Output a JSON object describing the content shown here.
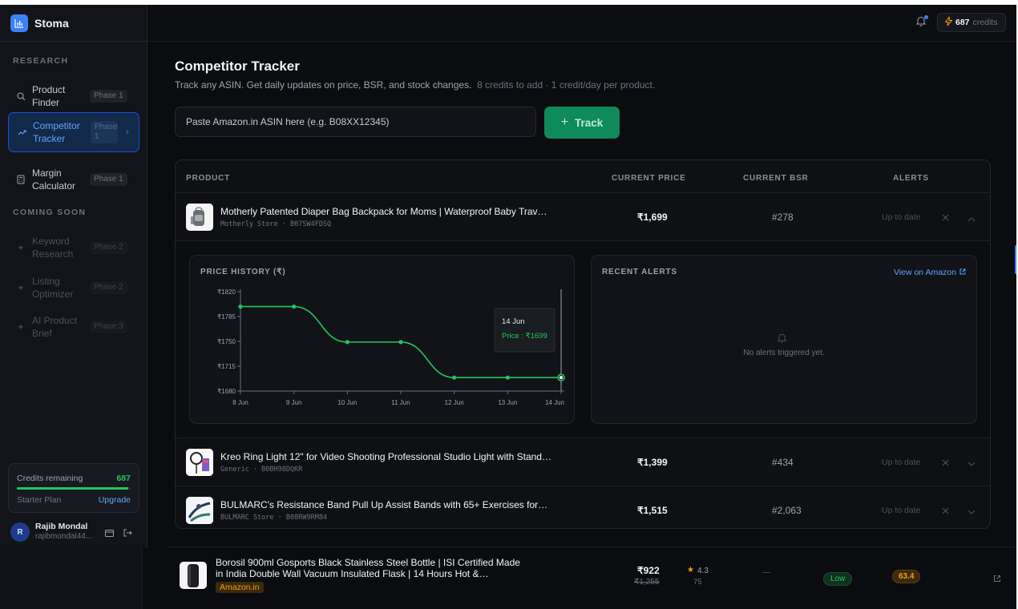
{
  "brand": {
    "name": "Stoma"
  },
  "sidebar": {
    "research_heading": "RESEARCH",
    "coming_soon_heading": "COMING SOON",
    "items": [
      {
        "label": "Product Finder",
        "badge": "Phase 1",
        "icon": "search-icon"
      },
      {
        "label": "Competitor Tracker",
        "badge": "Phase 1",
        "icon": "trend-icon"
      },
      {
        "label": "Margin Calculator",
        "badge": "Phase 1",
        "icon": "calculator-icon"
      },
      {
        "label": "Keyword Research",
        "badge": "Phase 2",
        "icon": "sparkle-icon"
      },
      {
        "label": "Listing Optimizer",
        "badge": "Phase 2",
        "icon": "sparkle-icon"
      },
      {
        "label": "AI Product Brief",
        "badge": "Phase 3",
        "icon": "sparkle-icon"
      }
    ],
    "credits": {
      "label": "Credits remaining",
      "value": "687",
      "fill_pct": 97,
      "plan": "Starter Plan",
      "upgrade": "Upgrade"
    },
    "user": {
      "initial": "R",
      "name": "Rajib Mondal",
      "email": "rajibmondal44..."
    }
  },
  "topbar": {
    "credits_num": "687",
    "credits_word": "credits"
  },
  "page": {
    "title": "Competitor Tracker",
    "subtitle": "Track any ASIN. Get daily updates on price, BSR, and stock changes.",
    "subtitle_note": "8 credits to add · 1 credit/day per product.",
    "input_placeholder": "Paste Amazon.in ASIN here (e.g. B08XX12345)",
    "track_label": "Track"
  },
  "table": {
    "headers": {
      "product": "PRODUCT",
      "price": "CURRENT PRICE",
      "bsr": "CURRENT BSR",
      "alerts": "ALERTS"
    },
    "rows": [
      {
        "name": "Motherly Patented Diaper Bag Backpack for Moms | Waterproof Baby Trav…",
        "meta": "Motherly Store · B07SW4FDSQ",
        "price": "₹1,699",
        "bsr": "#278",
        "status": "Up to date"
      },
      {
        "name": "Kreo Ring Light 12\" for Video Shooting Professional Studio Light with Stand…",
        "meta": "Generic · B0BH98DQKR",
        "price": "₹1,399",
        "bsr": "#434",
        "status": "Up to date"
      },
      {
        "name": "BULMARC's Resistance Band Pull Up Assist Bands with 65+ Exercises for…",
        "meta": "BULMARC Store · B08RW9RM84",
        "price": "₹1,515",
        "bsr": "#2,063",
        "status": "Up to date"
      }
    ],
    "expanded": {
      "price_history_title": "PRICE HISTORY (₹)",
      "recent_alerts_title": "RECENT ALERTS",
      "view_link": "View on Amazon",
      "empty_text": "No alerts triggered yet.",
      "tooltip": {
        "date": "14 Jun",
        "text": "Price : ₹1699"
      }
    }
  },
  "chart_data": {
    "type": "line",
    "x": [
      "8 Jun",
      "9 Jun",
      "10 Jun",
      "11 Jun",
      "12 Jun",
      "13 Jun",
      "14 Jun"
    ],
    "series": [
      {
        "values": [
          1799,
          1799,
          1749,
          1749,
          1699,
          1699,
          1699
        ]
      }
    ],
    "yticks": [
      "₹1820",
      "₹1785",
      "₹1750",
      "₹1715",
      "₹1680"
    ],
    "ytick_values": [
      1820,
      1785,
      1750,
      1715,
      1680
    ],
    "ylim": [
      1680,
      1820
    ],
    "grid": false,
    "color": "#22c55e"
  },
  "bottom_row": {
    "name": "Borosil 900ml Gosports Black Stainless Steel Bottle | ISI Certified Made in India Double Wall Vacuum Insulated Flask | 14 Hours Hot &…",
    "store": "Amazon.in",
    "price": "₹922",
    "old_price": "₹1,255",
    "rating": "4.3",
    "reviews": "75",
    "competition": "Low",
    "score": "63.4"
  },
  "colors": {
    "accent": "#3b82f6",
    "success": "#22c55e",
    "warning": "#f59e0b",
    "track_button": "#0f8a5a"
  }
}
